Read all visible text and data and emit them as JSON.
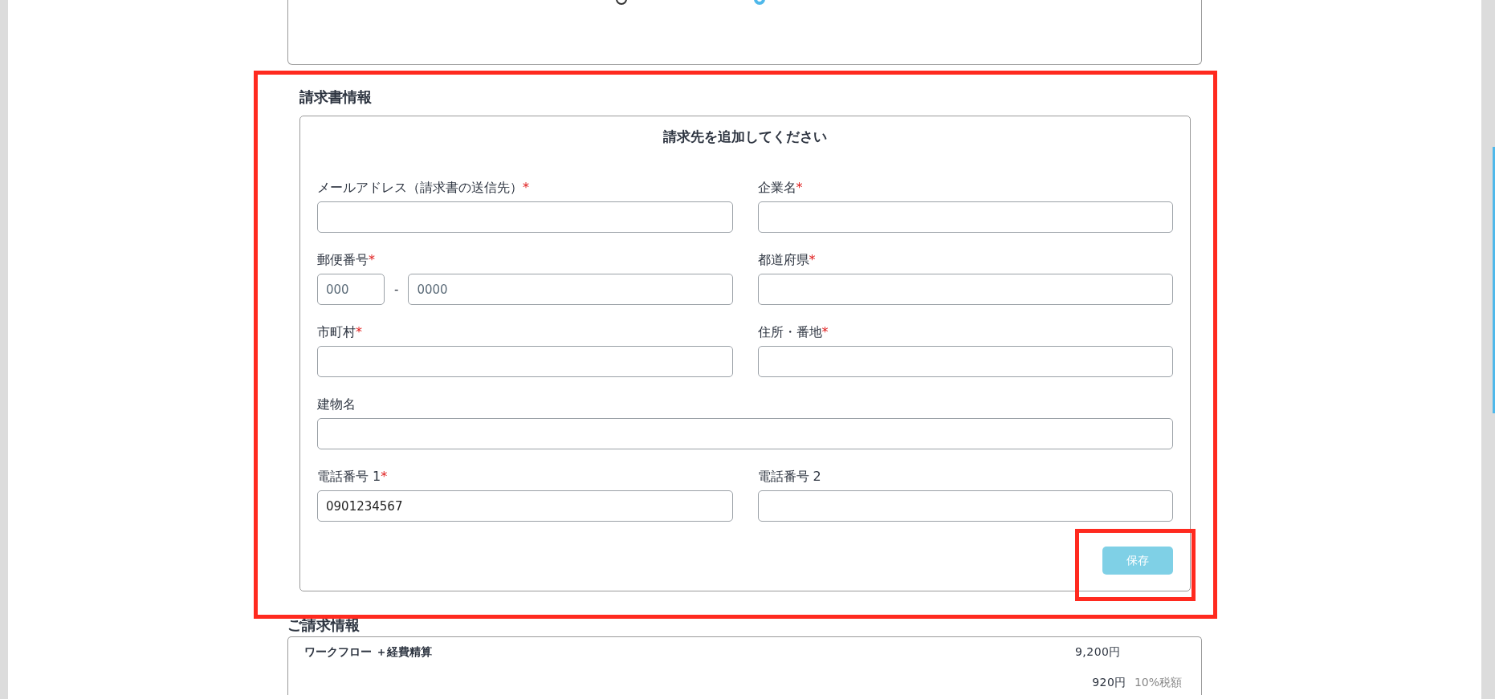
{
  "payment_methods": [
    {
      "selected": false
    },
    {
      "selected": true
    }
  ],
  "billing_section": {
    "title": "請求書情報",
    "highlighted": true,
    "form_title": "請求先を追加してください",
    "required_mark": "*",
    "rows": [
      [
        {
          "kind": "text",
          "label": "メールアドレス（請求書の送信先）",
          "required": true
        },
        {
          "kind": "text",
          "label": "企業名",
          "required": true
        }
      ],
      [
        {
          "kind": "postal",
          "label": "郵便番号",
          "required": true,
          "separator": "-",
          "parts": [
            {
              "placeholder": "000"
            },
            {
              "placeholder": "0000"
            }
          ]
        },
        {
          "kind": "text",
          "label": "都道府県",
          "required": true
        }
      ],
      [
        {
          "kind": "text",
          "label": "市町村",
          "required": true
        },
        {
          "kind": "text",
          "label": "住所・番地",
          "required": true
        }
      ],
      [
        {
          "kind": "text",
          "label": "建物名",
          "required": false
        }
      ],
      [
        {
          "kind": "text",
          "label": "電話番号 1",
          "required": true,
          "value": "0901234567"
        },
        {
          "kind": "text",
          "label": "電話番号 2",
          "required": false
        }
      ]
    ],
    "save_button": {
      "label": "保存",
      "disabled": true,
      "highlighted": true
    }
  },
  "summary": {
    "title": "ご請求情報",
    "rows": [
      {
        "label": "ワークフロー ＋経費精算",
        "amount": "9,200円"
      },
      {
        "amount": "920円",
        "note": "10%税額"
      }
    ]
  }
}
